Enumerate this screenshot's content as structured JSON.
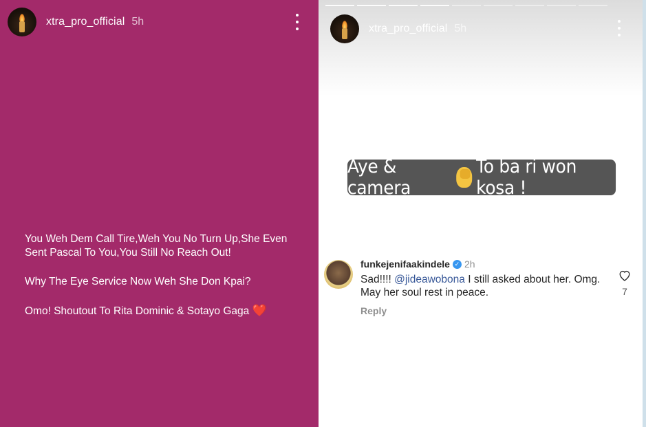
{
  "left_story": {
    "username": "xtra_pro_official",
    "time": "5h",
    "lines": [
      "You Weh Dem Call Tire,Weh You No Turn Up,She Even Sent Pascal To You,You Still No Reach Out!",
      "Why The Eye Service Now Weh She Don Kpai?",
      "Omo! Shoutout To Rita Dominic & Sotayo Gaga"
    ],
    "heart": "❤️",
    "background": "#a32a6a"
  },
  "right_story": {
    "username": "xtra_pro_official",
    "time": "5h",
    "caption_before": "Aye & camera",
    "caption_after": "To ba ri won kosa !",
    "comment": {
      "user": "funkejenifaakindele",
      "verified": true,
      "time": "2h",
      "text_before": "Sad!!!! ",
      "mention": "@jideawobona",
      "text_after": " I still asked about her. Omg. May her soul rest in peace.",
      "reply": "Reply",
      "likes": "7"
    }
  },
  "icons": [
    "avatar-candle",
    "more-options-icon",
    "verified-icon",
    "heart-outline-icon",
    "facepalm-emoji",
    "heart-emoji"
  ]
}
